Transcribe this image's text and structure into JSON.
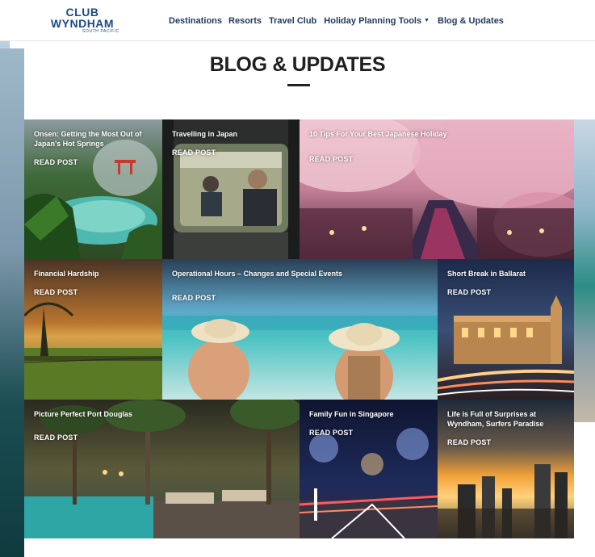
{
  "header": {
    "logo": {
      "line1": "CLUB",
      "line2": "WYNDHAM",
      "line3": "SOUTH PACIFIC"
    },
    "nav": [
      {
        "label": "Destinations"
      },
      {
        "label": "Resorts"
      },
      {
        "label": "Travel Club"
      },
      {
        "label": "Holiday Planning Tools"
      },
      {
        "label": "Blog & Updates"
      }
    ]
  },
  "page": {
    "title": "BLOG & UPDATES"
  },
  "posts": [
    {
      "title": "Onsen: Getting the Most Out of Japan's Hot Springs",
      "cta": "READ POST"
    },
    {
      "title": "Travelling in Japan",
      "cta": "READ POST"
    },
    {
      "title": "10 Tips For Your Best Japanese Holiday",
      "cta": "READ POST"
    },
    {
      "title": "Financial Hardship",
      "cta": "READ POST"
    },
    {
      "title": "Operational Hours – Changes and Special Events",
      "cta": "READ POST"
    },
    {
      "title": "Short Break in Ballarat",
      "cta": "READ POST"
    },
    {
      "title": "Picture Perfect Port Douglas",
      "cta": "READ POST"
    },
    {
      "title": "Family Fun in Singapore",
      "cta": "READ POST"
    },
    {
      "title": "Life is Full of Surprises at Wyndham, Surfers Paradise",
      "cta": "READ POST"
    }
  ]
}
